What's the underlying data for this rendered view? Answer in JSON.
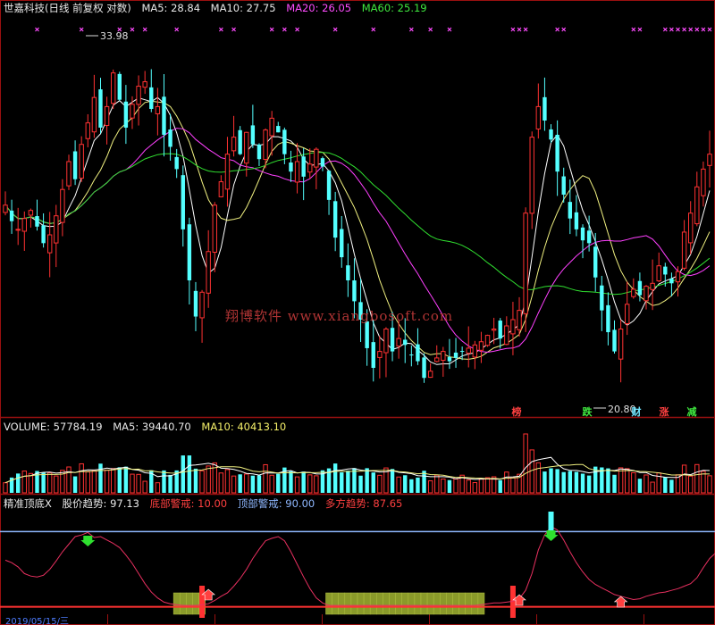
{
  "header": {
    "title": "世嘉科技(日线 前复权 对数)",
    "ma5": "MA5: 28.84",
    "ma10": "MA10: 27.75",
    "ma20": "MA20: 26.05",
    "ma60": "MA60: 25.19"
  },
  "volume_header": {
    "volume": "VOLUME: 57784.19",
    "ma5": "MA5: 39440.70",
    "ma10": "MA10: 40413.10"
  },
  "indicator_header": {
    "name": "精准顶底X",
    "trend": "股价趋势: 97.13",
    "bottom_alert": "底部警戒: 10.00",
    "top_alert": "顶部警戒: 90.00",
    "bull_trend": "多方趋势: 87.65"
  },
  "annotations": {
    "high_label": "33.98",
    "low_label": "20.80",
    "watermark": "翔博软件 www.xiangbosoft.com",
    "date_stub": "2019/05/15/三"
  },
  "event_tags": [
    {
      "label": "榜",
      "color": "#ff4040"
    },
    {
      "label": "跌",
      "color": "#3fe83f"
    },
    {
      "label": "财",
      "color": "#70e6ff"
    },
    {
      "label": "涨",
      "color": "#ff4040"
    },
    {
      "label": "减",
      "color": "#3fe83f"
    }
  ],
  "colors": {
    "up_candle": "#ff3232",
    "down_candle": "#54ffff",
    "ma5": "#ffffff",
    "ma10": "#f0f080",
    "ma20": "#ff40ff",
    "ma60": "#30e030",
    "grid": "#9a1010",
    "trend_line": "#e83060",
    "top_line": "#8fb8ff"
  },
  "chart_data": {
    "type": "candlestick",
    "closes": [
      26.8,
      26.2,
      25.9,
      26.3,
      26.6,
      26.0,
      25.4,
      25.7,
      26.4,
      27.4,
      28.5,
      27.8,
      29.2,
      30.1,
      31.2,
      29.9,
      30.8,
      32.3,
      31.1,
      29.9,
      30.9,
      31.7,
      31.9,
      30.7,
      30.8,
      29.6,
      29.1,
      28.2,
      25.9,
      24.1,
      22.9,
      23.7,
      25.1,
      26.8,
      27.7,
      28.8,
      29.5,
      28.8,
      29.7,
      29.2,
      28.6,
      29.8,
      30.3,
      29.7,
      28.8,
      28.1,
      28.5,
      27.9,
      28.4,
      29.0,
      28.3,
      27.0,
      25.6,
      24.9,
      24.1,
      23.4,
      22.8,
      21.9,
      21.3,
      21.8,
      22.5,
      21.8,
      22.2,
      22.0,
      21.7,
      21.5,
      21.0,
      21.2,
      21.6,
      21.8,
      21.5,
      21.6,
      21.8,
      21.9,
      22.0,
      22.1,
      22.3,
      22.5,
      22.2,
      22.6,
      22.8,
      23.1,
      26.5,
      29.5,
      30.8,
      30.2,
      29.4,
      28.1,
      27.2,
      26.3,
      25.9,
      25.5,
      25.4,
      24.2,
      23.1,
      22.4,
      21.8,
      22.5,
      23.3,
      23.8,
      23.6,
      23.9,
      24.0,
      24.6,
      24.3,
      24.0,
      24.4,
      25.8,
      26.5,
      27.5,
      28.2,
      28.8
    ],
    "volume": {
      "value": 57784.19,
      "ma5": 39440.7,
      "ma10": 40413.1
    },
    "ma5": 28.84,
    "ma10": 27.75,
    "ma20": 26.05,
    "ma60": 25.19,
    "high": 33.98,
    "low": 20.8,
    "indicator": {
      "trend": 97.13,
      "bottom_alert": 10.0,
      "top_alert": 90.0,
      "bull_trend": 87.65,
      "series": [
        56,
        53,
        48,
        40,
        37,
        36,
        38,
        45,
        55,
        66,
        75,
        84,
        86,
        89,
        83,
        84,
        80,
        76,
        71,
        62,
        52,
        40,
        28,
        18,
        11,
        6,
        4,
        3,
        2,
        2,
        2,
        3,
        4,
        8,
        13,
        17,
        25,
        34,
        45,
        58,
        69,
        79,
        82,
        84,
        79,
        66,
        51,
        36,
        22,
        11,
        5,
        2,
        2,
        2,
        2,
        2,
        2,
        2,
        2,
        2,
        2,
        2,
        2,
        2,
        2,
        2,
        2,
        2,
        2,
        2,
        2,
        2,
        2,
        2,
        2,
        3,
        4,
        5,
        5,
        6,
        7,
        10,
        20,
        40,
        68,
        86,
        96,
        92,
        80,
        66,
        53,
        42,
        33,
        27,
        23,
        19,
        15,
        13,
        11,
        9,
        10,
        13,
        15,
        17,
        18,
        20,
        22,
        25,
        28,
        35,
        47,
        58,
        65,
        70,
        77,
        85,
        91
      ]
    }
  }
}
